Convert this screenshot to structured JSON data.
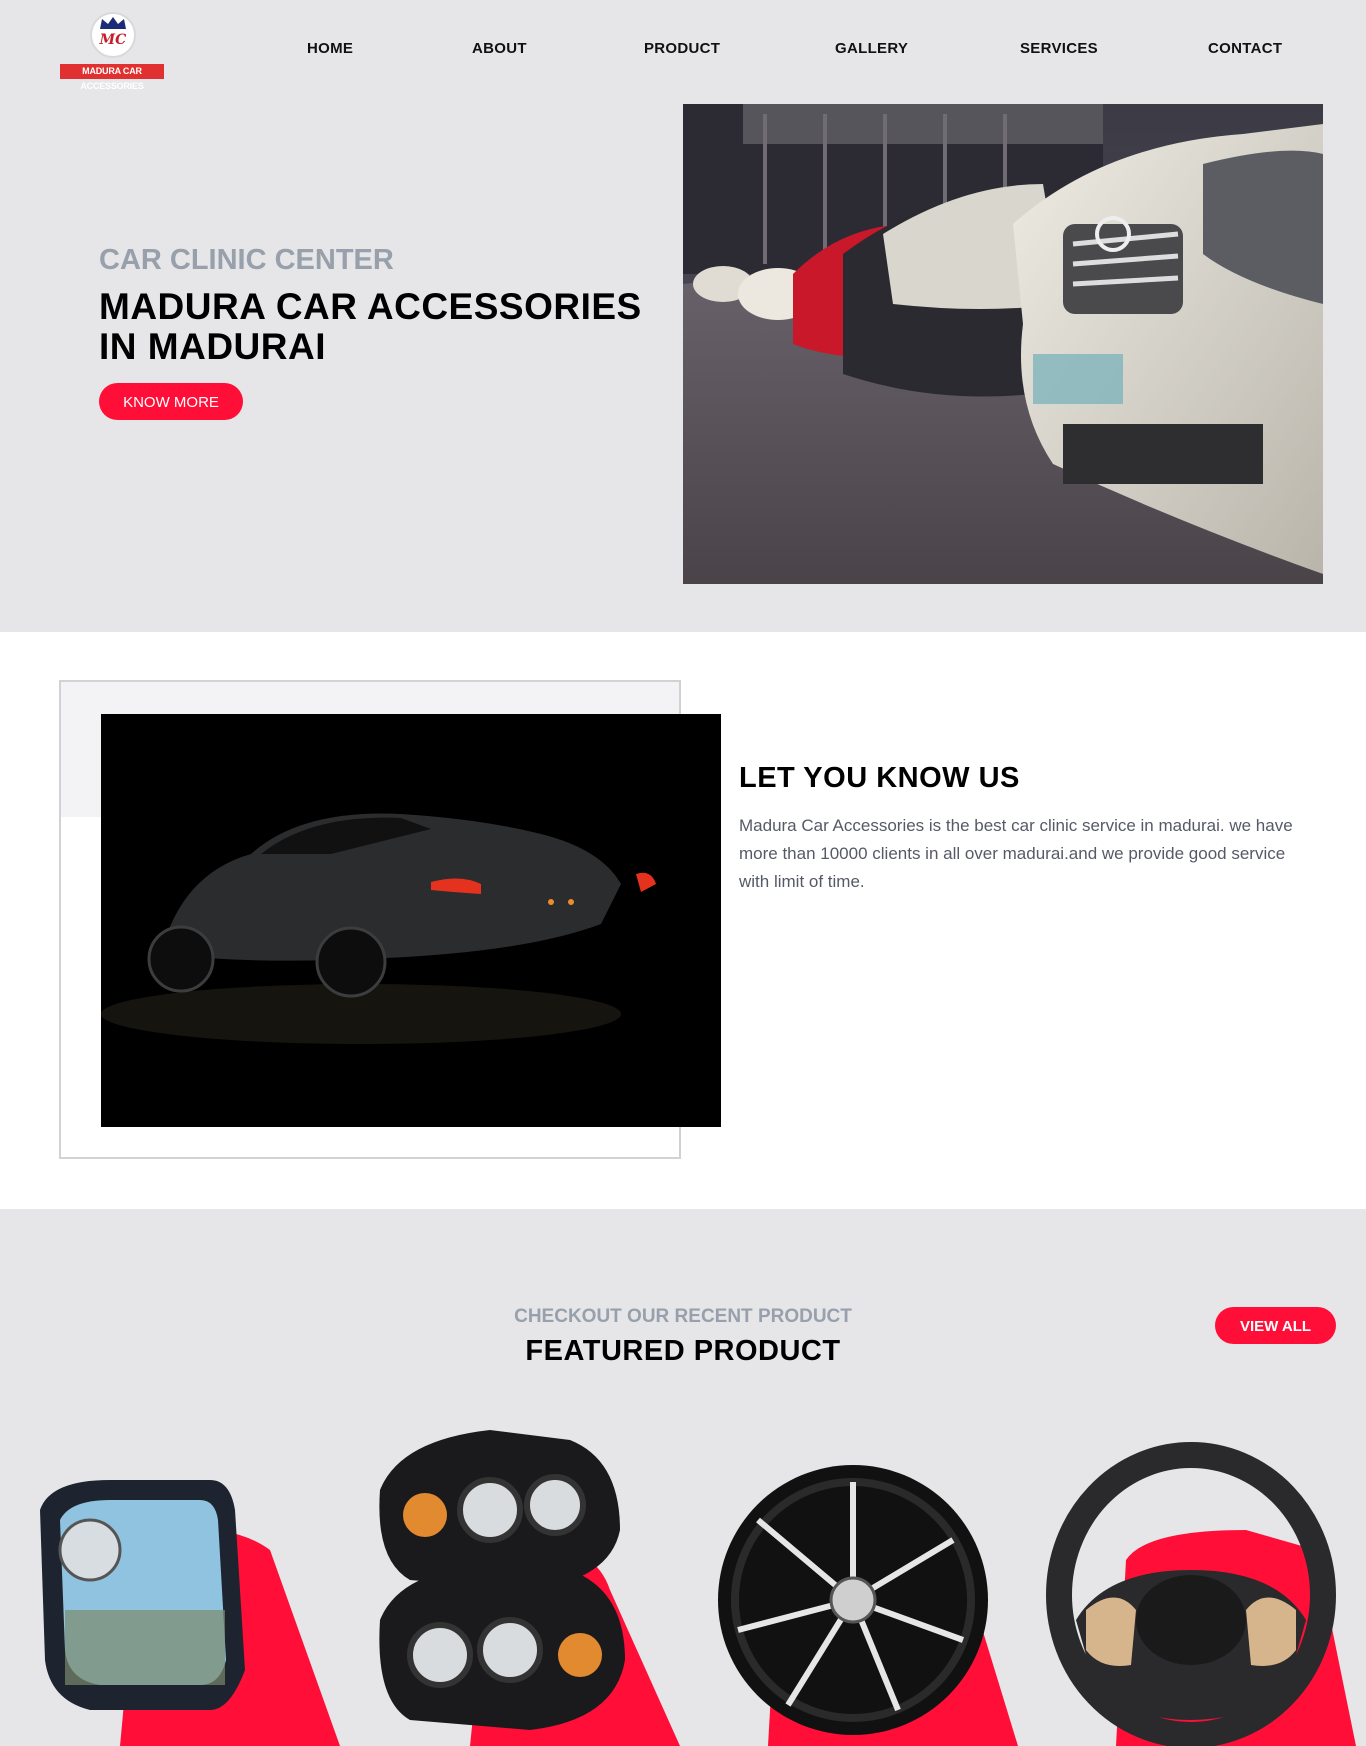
{
  "brand": {
    "logo_initials": "MC",
    "logo_text": "MADURA CAR ACCESSORIES"
  },
  "nav": [
    {
      "label": "HOME"
    },
    {
      "label": "ABOUT"
    },
    {
      "label": "PRODUCT"
    },
    {
      "label": "GALLERY"
    },
    {
      "label": "SERVICES"
    },
    {
      "label": "CONTACT"
    }
  ],
  "hero": {
    "subtitle": "CAR CLINIC CENTER",
    "title": "MADURA CAR ACCESSORIES IN MADURAI",
    "button": "KNOW MORE"
  },
  "about": {
    "title": "LET YOU KNOW US",
    "text": "Madura Car Accessories is the best car clinic service in madurai. we have more than 10000 clients in all over madurai.and we provide good service with limit of time."
  },
  "products": {
    "subtitle": "CHECKOUT OUR RECENT PRODUCT",
    "title": "FEATURED PRODUCT",
    "view_all": "VIEW ALL",
    "items": [
      {
        "icon": "side-mirror-icon"
      },
      {
        "icon": "headlight-icon"
      },
      {
        "icon": "alloy-wheel-icon"
      },
      {
        "icon": "steering-wheel-icon"
      }
    ]
  },
  "colors": {
    "accent": "#ff0f37",
    "muted": "#97a0ab",
    "bg": "#e6e6e9"
  }
}
